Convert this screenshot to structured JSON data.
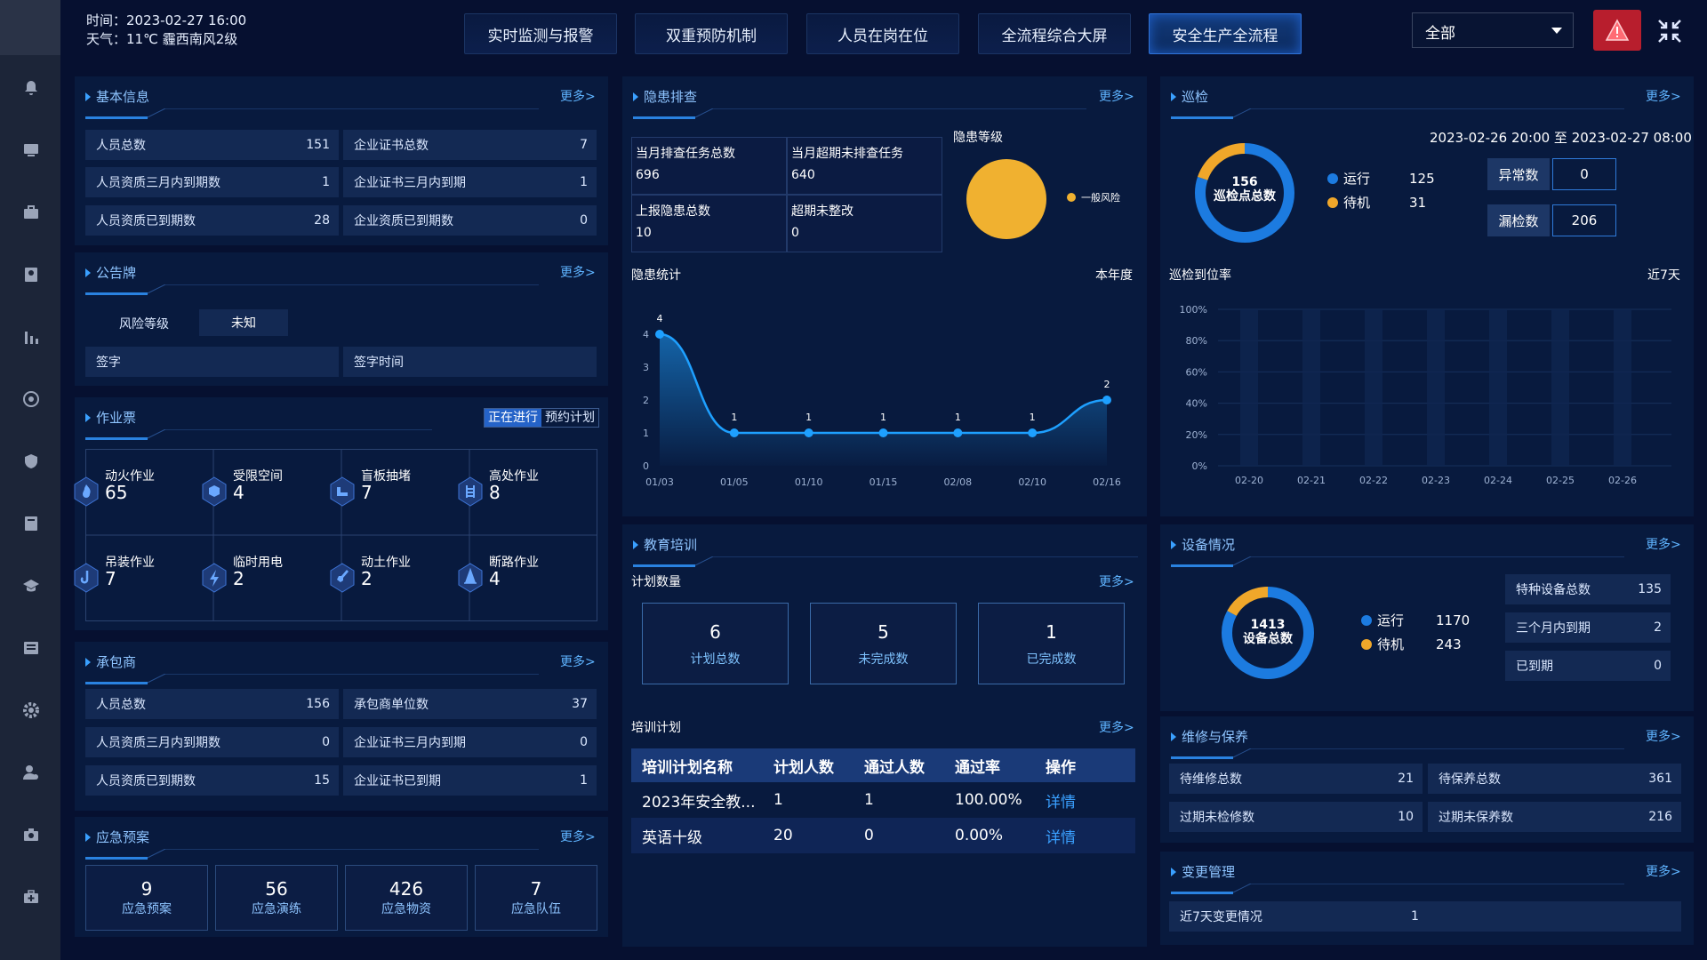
{
  "header": {
    "time_label": "时间：2023-02-27 16:00",
    "weather_label": "天气：11℃ 霾西南风2级",
    "nav": [
      "实时监测与报警",
      "双重预防机制",
      "人员在岗在位",
      "全流程综合大屏",
      "安全生产全流程"
    ],
    "active_nav_index": 4,
    "select_value": "全部"
  },
  "colors": {
    "accent": "#2f73d9",
    "alert": "#b81e2d",
    "orange": "#f0a72a",
    "blue": "#1c7be0"
  },
  "more_label": "更多>",
  "basic_info": {
    "title": "基本信息",
    "rows": [
      {
        "l1": "人员总数",
        "v1": "151",
        "l2": "企业证书总数",
        "v2": "7"
      },
      {
        "l1": "人员资质三月内到期数",
        "v1": "1",
        "l2": "企业证书三月内到期",
        "v2": "1"
      },
      {
        "l1": "人员资质已到期数",
        "v1": "28",
        "l2": "企业资质已到期数",
        "v2": "0"
      }
    ]
  },
  "notice": {
    "title": "公告牌",
    "risk_label": "风险等级",
    "risk_value": "未知",
    "sign_label": "签字",
    "sign_time_label": "签字时间"
  },
  "tickets": {
    "title": "作业票",
    "tab_active": "正在进行",
    "tab_other": "预约计划",
    "items": [
      {
        "label": "动火作业",
        "value": "65",
        "icon": "fire-icon"
      },
      {
        "label": "受限空间",
        "value": "4",
        "icon": "box-icon"
      },
      {
        "label": "盲板抽堵",
        "value": "7",
        "icon": "pipe-icon"
      },
      {
        "label": "高处作业",
        "value": "8",
        "icon": "ladder-icon"
      },
      {
        "label": "吊装作业",
        "value": "7",
        "icon": "hook-icon"
      },
      {
        "label": "临时用电",
        "value": "2",
        "icon": "lightning-icon"
      },
      {
        "label": "动土作业",
        "value": "2",
        "icon": "shovel-icon"
      },
      {
        "label": "断路作业",
        "value": "4",
        "icon": "cone-icon"
      }
    ]
  },
  "contractor": {
    "title": "承包商",
    "rows": [
      {
        "l1": "人员总数",
        "v1": "156",
        "l2": "承包商单位数",
        "v2": "37"
      },
      {
        "l1": "人员资质三月内到期数",
        "v1": "0",
        "l2": "企业证书三月内到期",
        "v2": "0"
      },
      {
        "l1": "人员资质已到期数",
        "v1": "15",
        "l2": "企业证书已到期",
        "v2": "1"
      }
    ]
  },
  "emergency": {
    "title": "应急预案",
    "items": [
      {
        "value": "9",
        "label": "应急预案"
      },
      {
        "value": "56",
        "label": "应急演练"
      },
      {
        "value": "426",
        "label": "应急物资"
      },
      {
        "value": "7",
        "label": "应急队伍"
      }
    ]
  },
  "hazard": {
    "title": "隐患排查",
    "cells": [
      {
        "label": "当月排查任务总数",
        "value": "696"
      },
      {
        "label": "当月超期未排查任务",
        "value": "640"
      },
      {
        "label": "上报隐患总数",
        "value": "10"
      },
      {
        "label": "超期未整改",
        "value": "0"
      }
    ],
    "level_title": "隐患等级",
    "level_legend": "一般风险",
    "stats_title": "隐患统计",
    "period": "本年度"
  },
  "training": {
    "title": "教育培训",
    "plan_count_label": "计划数量",
    "boxes": [
      {
        "value": "6",
        "label": "计划总数"
      },
      {
        "value": "5",
        "label": "未完成数"
      },
      {
        "value": "1",
        "label": "已完成数"
      }
    ],
    "plan_title": "培训计划",
    "headers": [
      "培训计划名称",
      "计划人数",
      "通过人数",
      "通过率",
      "操作"
    ],
    "rows": [
      [
        "2023年安全教...",
        "1",
        "1",
        "100.00%",
        "详情"
      ],
      [
        "英语十级",
        "20",
        "0",
        "0.00%",
        "详情"
      ]
    ]
  },
  "patrol": {
    "title": "巡检",
    "range": "2023-02-26 20:00 至 2023-02-27 08:00",
    "donut_value": "156",
    "donut_label": "巡检点总数",
    "running_label": "运行",
    "running_value": "125",
    "standby_label": "待机",
    "standby_value": "31",
    "abnormal_label": "异常数",
    "abnormal_value": "0",
    "missed_label": "漏检数",
    "missed_value": "206",
    "rate_title": "巡检到位率",
    "rate_period": "近7天"
  },
  "equipment": {
    "title": "设备情况",
    "donut_value": "1413",
    "donut_label": "设备总数",
    "running_label": "运行",
    "running_value": "1170",
    "standby_label": "待机",
    "standby_value": "243",
    "rows": [
      {
        "label": "特种设备总数",
        "value": "135"
      },
      {
        "label": "三个月内到期",
        "value": "2"
      },
      {
        "label": "已到期",
        "value": "0"
      }
    ]
  },
  "maintenance": {
    "title": "维修与保养",
    "rows": [
      {
        "l1": "待维修总数",
        "v1": "21",
        "l2": "待保养总数",
        "v2": "361"
      },
      {
        "l1": "过期未检修数",
        "v1": "10",
        "l2": "过期未保养数",
        "v2": "216"
      }
    ]
  },
  "change": {
    "title": "变更管理",
    "label": "近7天变更情况",
    "value": "1"
  },
  "chart_data": [
    {
      "type": "area",
      "title": "隐患统计",
      "categories": [
        "01/03",
        "01/05",
        "01/10",
        "01/15",
        "02/08",
        "02/10",
        "02/16"
      ],
      "values": [
        4,
        1,
        1,
        1,
        1,
        1,
        2
      ],
      "ylim": [
        0,
        4
      ],
      "yticks": [
        "0",
        "1",
        "2",
        "3",
        "4"
      ]
    },
    {
      "type": "bar",
      "title": "巡检到位率",
      "categories": [
        "02-20",
        "02-21",
        "02-22",
        "02-23",
        "02-24",
        "02-25",
        "02-26"
      ],
      "values": [
        0,
        0,
        0,
        0,
        0,
        0,
        0
      ],
      "ylim": [
        0,
        100
      ],
      "yticks": [
        "0%",
        "20%",
        "40%",
        "60%",
        "80%",
        "100%"
      ]
    },
    {
      "type": "pie",
      "title": "隐患等级",
      "categories": [
        "一般风险"
      ],
      "values": [
        10
      ],
      "colors": [
        "#f0b130"
      ]
    },
    {
      "type": "pie",
      "title": "巡检",
      "categories": [
        "运行",
        "待机"
      ],
      "values": [
        125,
        31
      ],
      "colors": [
        "#1c7be0",
        "#f0a72a"
      ]
    },
    {
      "type": "pie",
      "title": "设备情况",
      "categories": [
        "运行",
        "待机"
      ],
      "values": [
        1170,
        243
      ],
      "colors": [
        "#1c7be0",
        "#f0a72a"
      ]
    }
  ]
}
